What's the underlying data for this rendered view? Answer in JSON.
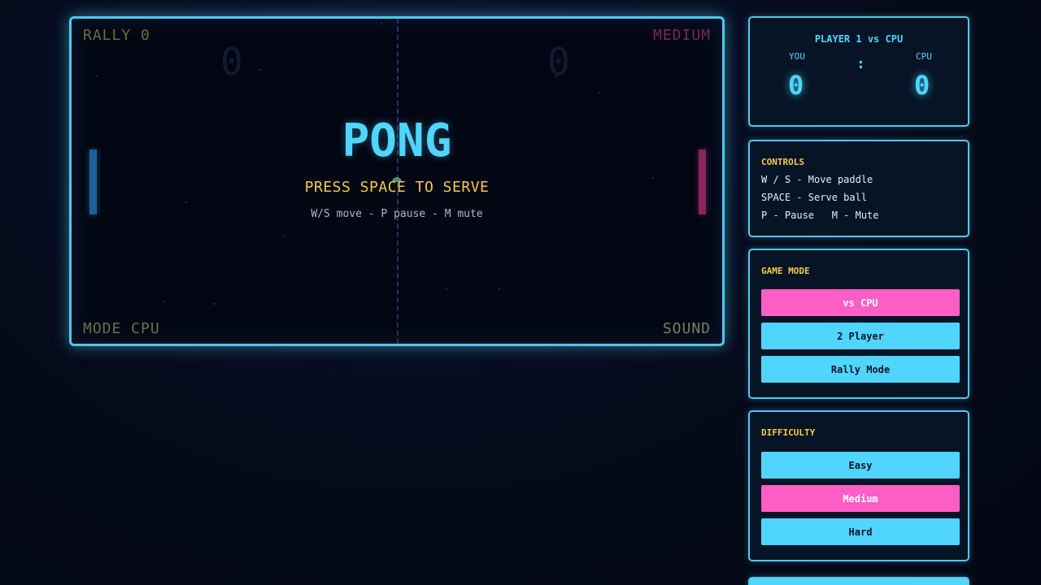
{
  "game": {
    "rally": "RALLY 0",
    "difficulty_label": "MEDIUM",
    "mode_label": "MODE CPU",
    "sound_label": "SOUND",
    "left_score": "0",
    "right_score": "0",
    "title": "PONG",
    "serve_prompt": "PRESS SPACE TO SERVE",
    "hint": "W/S move - P pause - M mute"
  },
  "scoreboard": {
    "title": "PLAYER 1 vs CPU",
    "you_label": "YOU",
    "cpu_label": "CPU",
    "separator": ":",
    "you_score": "0",
    "cpu_score": "0"
  },
  "controls": {
    "heading": "CONTROLS",
    "lines": [
      "W / S - Move paddle",
      "SPACE - Serve ball",
      "P - Pause   M - Mute"
    ]
  },
  "game_mode": {
    "heading": "GAME MODE",
    "options": [
      "vs CPU",
      "2 Player",
      "Rally Mode"
    ],
    "selected": "vs CPU"
  },
  "difficulty": {
    "heading": "DIFFICULTY",
    "options": [
      "Easy",
      "Medium",
      "Hard"
    ],
    "selected": "Medium"
  },
  "colors": {
    "accent": "#4fd5ff",
    "active": "#ff5ec4",
    "heading": "#f2c94c",
    "background": "#050a18"
  }
}
